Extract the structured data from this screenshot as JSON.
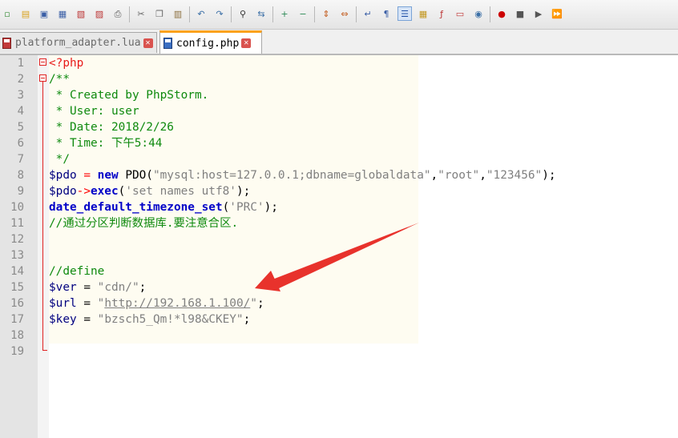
{
  "toolbar": {
    "icons": [
      "new-file-icon",
      "open-file-icon",
      "save-icon",
      "save-all-icon",
      "close-icon",
      "close-all-icon",
      "print-icon",
      "cut-icon",
      "copy-icon",
      "paste-icon",
      "undo-icon",
      "redo-icon",
      "find-icon",
      "replace-icon",
      "zoom-in-icon",
      "zoom-out-icon",
      "sync-vertical-icon",
      "sync-horizontal-icon",
      "word-wrap-icon",
      "show-all-chars-icon",
      "indent-guide-icon",
      "doc-map-icon",
      "function-list-icon",
      "folder-workspace-icon",
      "monitor-icon",
      "record-macro-icon",
      "stop-macro-icon",
      "play-macro-icon",
      "run-macro-multiple-icon"
    ]
  },
  "tabs": [
    {
      "label": "platform_adapter.lua",
      "active": false
    },
    {
      "label": "config.php",
      "active": true
    }
  ],
  "line_numbers": [
    "1",
    "2",
    "3",
    "4",
    "5",
    "6",
    "7",
    "8",
    "9",
    "10",
    "11",
    "12",
    "13",
    "14",
    "15",
    "16",
    "17",
    "18",
    "19"
  ],
  "code": {
    "l1": {
      "tag": "<?php"
    },
    "l2": {
      "cmt": "/**"
    },
    "l3": {
      "cmt": " * Created by PhpStorm."
    },
    "l4": {
      "cmt": " * User: user"
    },
    "l5": {
      "cmt": " * Date: 2018/2/26"
    },
    "l6": {
      "cmt": " * Time: 下午5:44"
    },
    "l7": {
      "cmt": " */"
    },
    "l8": {
      "var": "$pdo",
      "op1": " = ",
      "kw": "new",
      "cls": " PDO(",
      "s1": "\"mysql:host=127.0.0.1;dbname=globaldata\"",
      "c1": ",",
      "s2": "\"root\"",
      "c2": ",",
      "s3": "\"123456\"",
      "end": ");"
    },
    "l9": {
      "var": "$pdo",
      "op": "->",
      "fn": "exec",
      "p1": "(",
      "s1": "'set names utf8'",
      "end": ");"
    },
    "l10": {
      "fn": "date_default_timezone_set",
      "p1": "(",
      "s1": "'PRC'",
      "end": ");"
    },
    "l11": {
      "cmt": "//通过分区判断数据库.要注意合区."
    },
    "l14": {
      "cmt": "//define"
    },
    "l15": {
      "var": "$ver",
      "op": " = ",
      "s1": "\"cdn/\"",
      "end": ";"
    },
    "l16": {
      "var": "$url",
      "op": " = ",
      "q1": "\"",
      "url": "http://192.168.1.100/",
      "q2": "\"",
      "end": ";"
    },
    "l17": {
      "var": "$key",
      "op": " = ",
      "s1": "\"bzsch5_Qm!*l98&CKEY\"",
      "end": ";"
    }
  },
  "colors": {
    "tab_accent": "#fba21d",
    "arrow": "#e8322c",
    "comment": "#0f8a0f",
    "keyword": "#0000c8",
    "string": "#808080",
    "variable": "#000080"
  }
}
